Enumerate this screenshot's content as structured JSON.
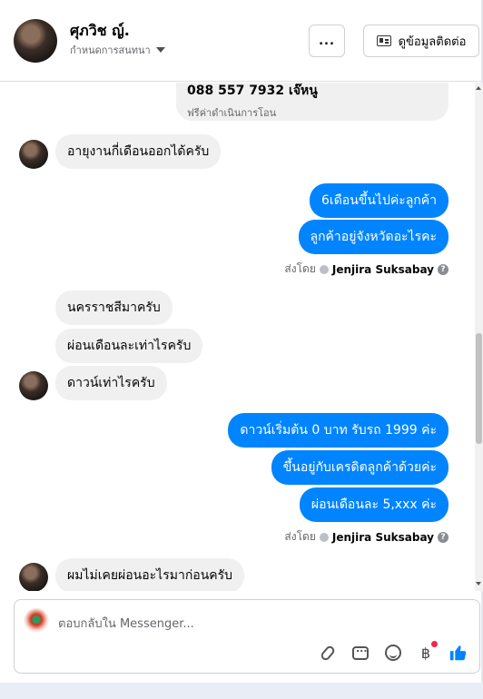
{
  "header": {
    "name": "ศุภวิช ญ์.",
    "subtitle": "กำหนดการสนทนา",
    "more_label": "...",
    "contact_label": "ดูข้อมูลติดต่อ"
  },
  "card": {
    "phone": "088 557 7932 เจ๊หนู",
    "note": "ฟรีค่าดำเนินการโอน"
  },
  "messages": {
    "m1": "อายุงานกี่เดือนออกได้ครับ",
    "m2": "6เดือนขึ้นไปค่ะลูกค้า",
    "m3": "ลูกค้าอยู่จังหวัดอะไรคะ",
    "sent1_prefix": "ส่งโดย",
    "sent1_name": "Jenjira Suksabay",
    "m4": "นครราชสีมาครับ",
    "m5": "ผ่อนเดือนละเท่าไรครับ",
    "m6": "ดาวน์เท่าไรครับ",
    "m7": "ดาวน์เริ่มต้น 0 บาท รับรถ 1999 ค่ะ",
    "m8": "ขึ้นอยู่กับเครดิตลูกค้าด้วยค่ะ",
    "m9": "ผ่อนเดือนละ 5,xxx ค่ะ",
    "sent2_prefix": "ส่งโดย",
    "sent2_name": "Jenjira Suksabay",
    "m10": "ผมไม่เคยผ่อนอะไรมาก่อนครับ"
  },
  "composer": {
    "placeholder": "ตอบกลับใน Messenger...",
    "currency_symbol": "฿"
  },
  "icons": [
    "more-icon",
    "contact-card-icon",
    "verified-icon",
    "help-icon",
    "attach-icon",
    "saved-replies-icon",
    "emoji-icon",
    "payment-icon",
    "like-icon"
  ],
  "colors": {
    "accent": "#0084ff",
    "incoming_bubble": "#f0f0f0",
    "notification": "#f02849"
  }
}
